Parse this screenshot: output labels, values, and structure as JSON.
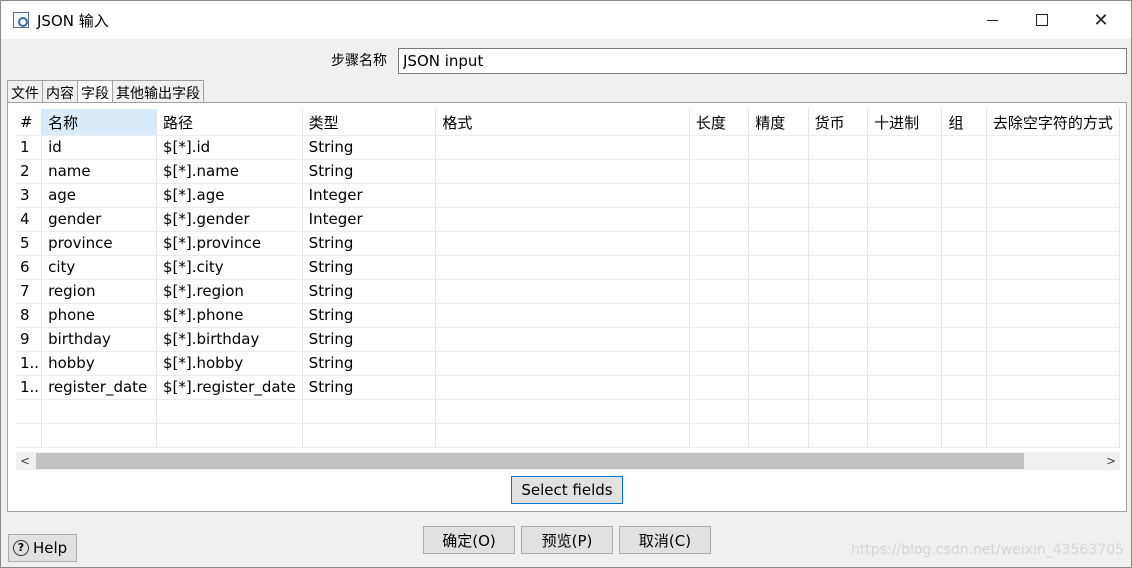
{
  "window": {
    "title": "JSON 输入",
    "app_icon": "transform-step-icon",
    "controls": {
      "minimize": "minimize-icon",
      "maximize": "maximize-icon",
      "close": "✕"
    }
  },
  "step": {
    "label": "步骤名称",
    "value": "JSON input"
  },
  "tabs": [
    {
      "label": "文件",
      "active": false
    },
    {
      "label": "内容",
      "active": false
    },
    {
      "label": "字段",
      "active": true
    },
    {
      "label": "其他输出字段",
      "active": false
    }
  ],
  "table": {
    "sort_indicator": "^",
    "columns": [
      "#",
      "名称",
      "路径",
      "类型",
      "格式",
      "长度",
      "精度",
      "货币",
      "十进制",
      "组",
      "去除空字符的方式"
    ],
    "rows": [
      {
        "num": "1",
        "name": "id",
        "path": "$[*].id",
        "type": "String"
      },
      {
        "num": "2",
        "name": "name",
        "path": "$[*].name",
        "type": "String"
      },
      {
        "num": "3",
        "name": "age",
        "path": "$[*].age",
        "type": "Integer"
      },
      {
        "num": "4",
        "name": "gender",
        "path": "$[*].gender",
        "type": "Integer"
      },
      {
        "num": "5",
        "name": "province",
        "path": "$[*].province",
        "type": "String"
      },
      {
        "num": "6",
        "name": "city",
        "path": "$[*].city",
        "type": "String"
      },
      {
        "num": "7",
        "name": "region",
        "path": "$[*].region",
        "type": "String"
      },
      {
        "num": "8",
        "name": "phone",
        "path": "$[*].phone",
        "type": "String"
      },
      {
        "num": "9",
        "name": "birthday",
        "path": "$[*].birthday",
        "type": "String"
      },
      {
        "num": "1..",
        "name": "hobby",
        "path": "$[*].hobby",
        "type": "String"
      },
      {
        "num": "1..",
        "name": "register_date",
        "path": "$[*].register_date",
        "type": "String"
      }
    ]
  },
  "scrollbar": {
    "left_arrow": "<",
    "right_arrow": ">"
  },
  "buttons": {
    "select_fields": "Select fields",
    "ok": "确定(O)",
    "preview": "预览(P)",
    "cancel": "取消(C)",
    "help": "Help",
    "help_icon": "?"
  },
  "watermark": "https://blog.csdn.net/weixin_43563705"
}
